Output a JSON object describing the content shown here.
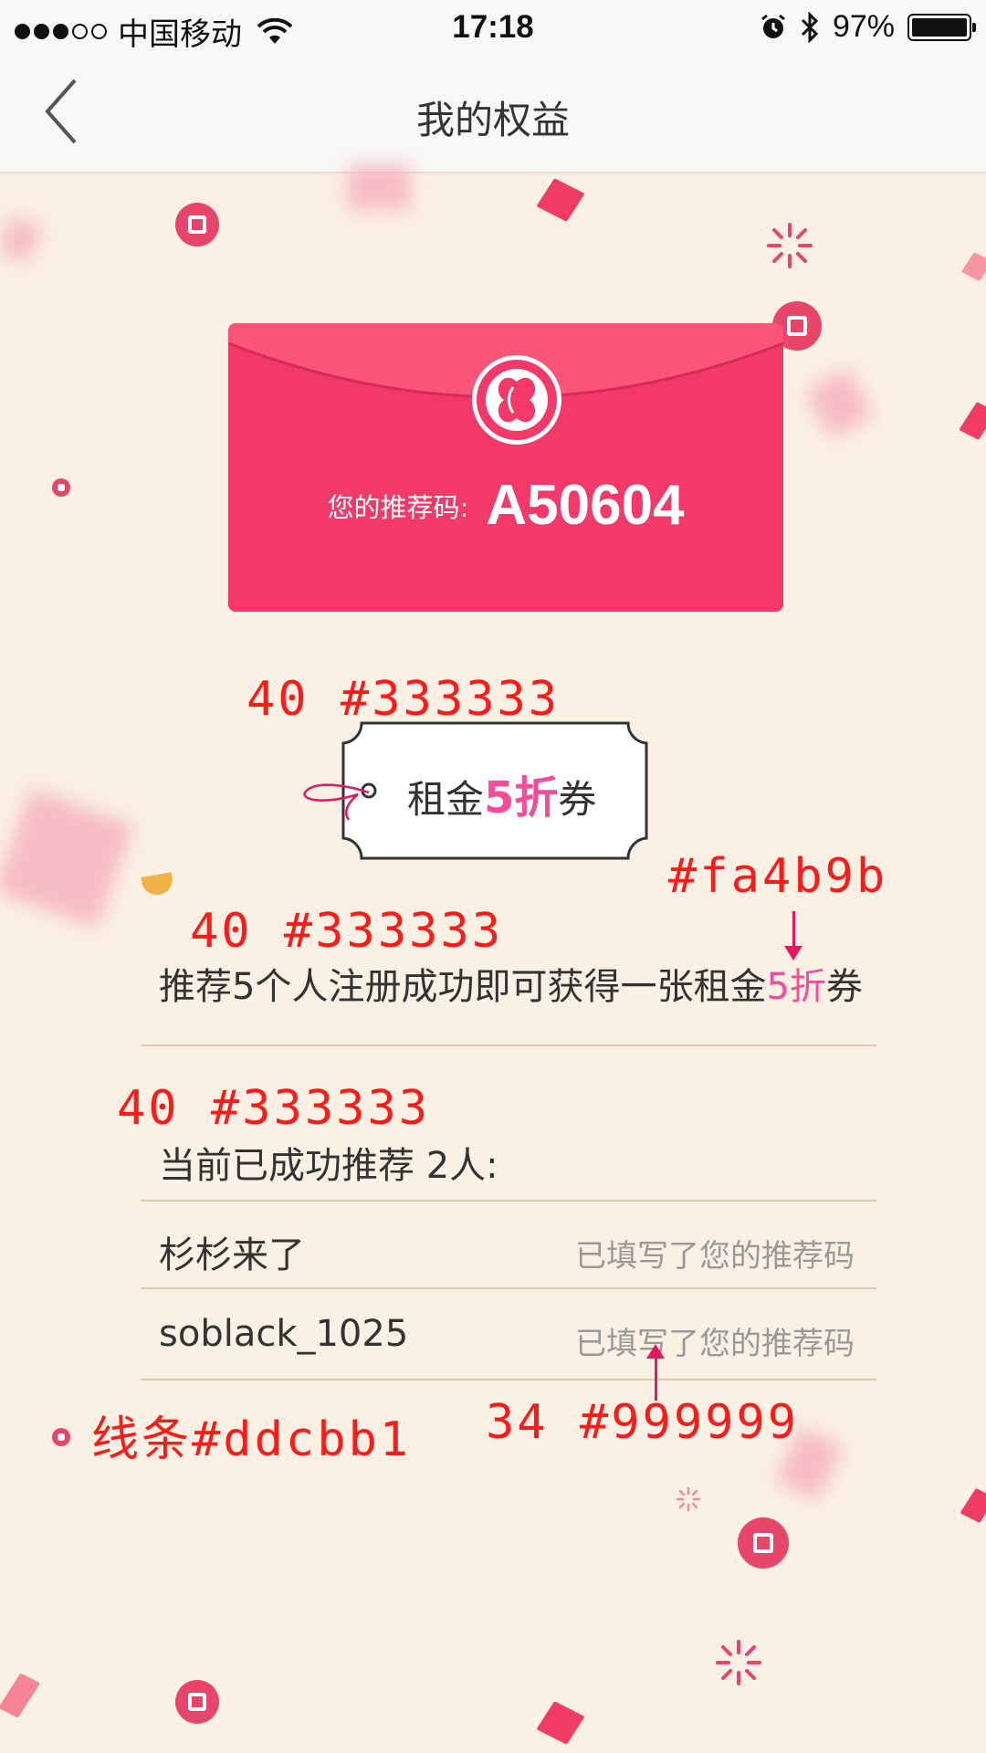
{
  "status_bar": {
    "carrier": "中国移动",
    "time": "17:18",
    "battery": "97%"
  },
  "nav": {
    "title": "我的权益"
  },
  "envelope": {
    "code_label": "您的推荐码:",
    "code": "A50604"
  },
  "ticket": {
    "prefix": "租金",
    "highlight": "5折",
    "suffix": "券"
  },
  "promo": {
    "text_prefix": "推荐5个人注册成功即可获得一张租金",
    "text_highlight": "5折",
    "text_suffix": "券"
  },
  "referrals": {
    "summary": "当前已成功推荐 2人:",
    "items": [
      {
        "name": "杉杉来了",
        "status": "已填写了您的推荐码"
      },
      {
        "name": "soblack_1025",
        "status": "已填写了您的推荐码"
      }
    ]
  },
  "annotations": {
    "ticket_spec": "40  #333333",
    "highlight_color": "#fa4b9b",
    "promo_spec": "40  #333333",
    "summary_spec": "40  #333333",
    "line_spec": "线条#ddcbb1",
    "status_spec": "34  #999999"
  },
  "colors": {
    "background": "#faf0e3",
    "envelope": "#f2396a",
    "text": "#333333",
    "highlight": "#fa4b9b",
    "divider": "#ddcbb1",
    "secondary_text": "#999999",
    "annotation": "#ff1a1a"
  }
}
